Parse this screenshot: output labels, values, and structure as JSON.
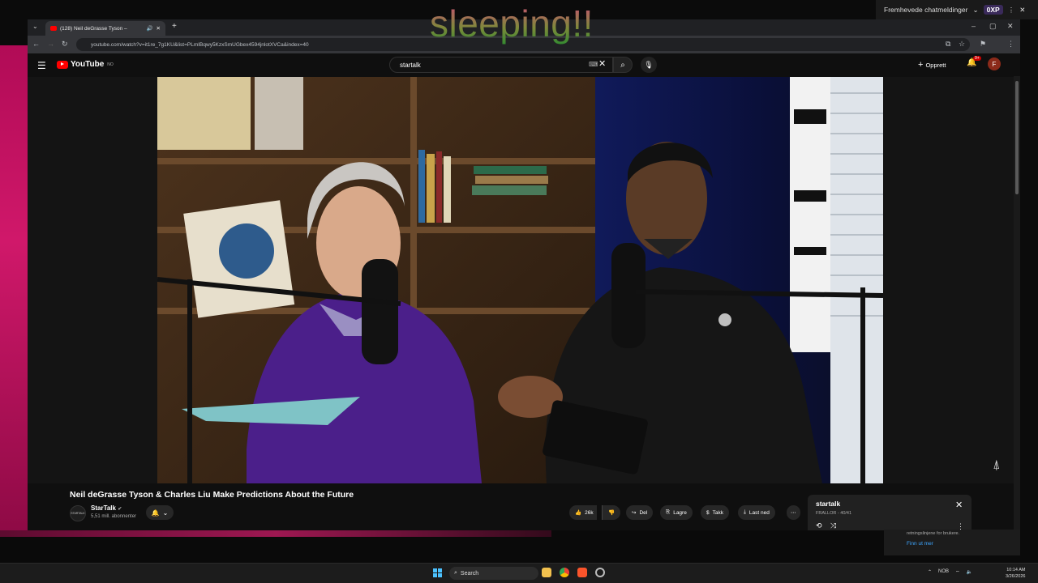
{
  "overlay": {
    "text": "sleeping!!"
  },
  "chat_widget": {
    "label": "Fremhevede chatmeldinger",
    "points": "0XP"
  },
  "browser": {
    "tab_title": "(128) Neil deGrasse Tyson –",
    "url": "youtube.com/watch?v=it1re_7g1KU&list=PLmIBqwy5KzxSmUGbex4594jnlotXVCa&index=40"
  },
  "youtube": {
    "logo_text": "YouTube",
    "country_code": "NO",
    "search_query": "startalk",
    "create_label": "Opprett",
    "notification_count": "9+",
    "avatar_letter": "F",
    "video_title": "Neil deGrasse Tyson & Charles Liu Make Predictions About the Future",
    "channel": {
      "name": "StarTalk",
      "avatar_text": "STARTALK",
      "subscribers": "5,51 mill. abonnenter"
    },
    "actions": {
      "likes": "26k",
      "share": "Del",
      "save": "Lagre",
      "thanks": "Takk",
      "download": "Last ned"
    },
    "playlist": {
      "title": "startalk",
      "subtitle": "FRALLOR - 40/41"
    },
    "notice": {
      "text": "retningslinjene for brukere.",
      "link": "Finn ut mer"
    }
  },
  "taskbar": {
    "search_label": "Search",
    "language": "NOB",
    "time": "10:14 AM",
    "date": "3/26/2026"
  },
  "colors": {
    "yt_red": "#ff0000",
    "overlay_pink": "#d04a78",
    "overlay_green": "#2f8a30"
  }
}
